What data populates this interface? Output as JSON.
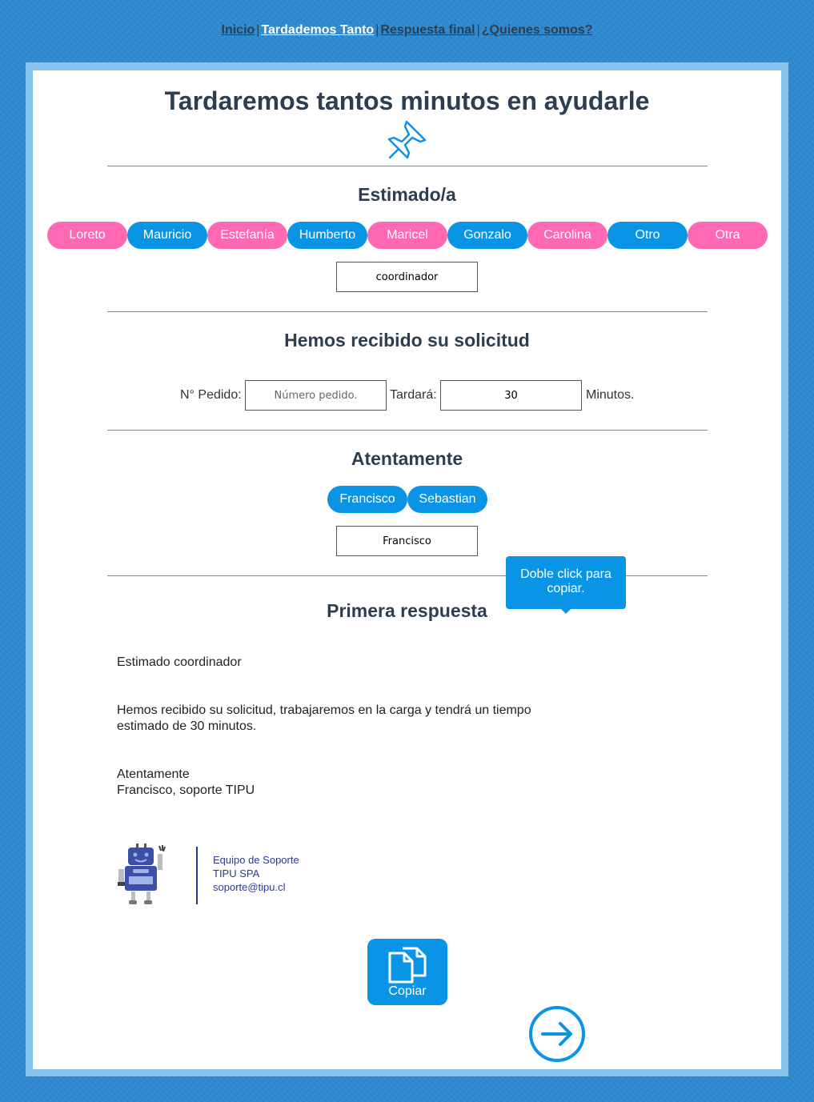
{
  "nav": {
    "items": [
      {
        "label": "Inicio",
        "active": false
      },
      {
        "label": "Tardademos Tanto",
        "active": true
      },
      {
        "label": "Respuesta final",
        "active": false
      },
      {
        "label": "¿Quienes somos?",
        "active": false
      }
    ],
    "separator": "|"
  },
  "page_title": "Tardaremos tantos minutos en ayudarle",
  "estimado": {
    "heading": "Estimado/a",
    "names": [
      {
        "label": "Loreto",
        "color": "pink"
      },
      {
        "label": "Mauricio",
        "color": "blue"
      },
      {
        "label": "Estefanía",
        "color": "pink"
      },
      {
        "label": "Humberto",
        "color": "blue"
      },
      {
        "label": "Maricel",
        "color": "pink"
      },
      {
        "label": "Gonzalo",
        "color": "blue"
      },
      {
        "label": "Carolina",
        "color": "pink"
      },
      {
        "label": "Otro",
        "color": "blue"
      },
      {
        "label": "Otra",
        "color": "pink"
      }
    ],
    "input_value": "coordinador"
  },
  "solicitud": {
    "heading": "Hemos recibido su solicitud",
    "pedido_label": "N° Pedido:",
    "pedido_placeholder": "Número pedido.",
    "tardara_label": "Tardará:",
    "minutes_value": "30",
    "minutes_label": "Minutos."
  },
  "atentamente": {
    "heading": "Atentamente",
    "names": [
      {
        "label": "Francisco",
        "color": "blue"
      },
      {
        "label": "Sebastian",
        "color": "blue"
      }
    ],
    "input_value": "Francisco"
  },
  "respuesta": {
    "heading": "Primera respuesta",
    "tooltip": "Doble click para copiar.",
    "greeting": "Estimado coordinador",
    "body": "Hemos recibido su solicitud, trabajaremos en la carga y tendrá un tiempo estimado de 30 minutos.",
    "closing": "Atentamente",
    "signer": "Francisco, soporte TIPU"
  },
  "signature": {
    "team": "Equipo de Soporte",
    "company": "TIPU SPA",
    "email": "soporte@tipu.cl"
  },
  "copy_button": {
    "label": "Copiar",
    "icon": "copy-icon"
  },
  "next_button": {
    "icon": "arrow-right-circle-icon"
  },
  "colors": {
    "pink": "#ff69b4",
    "blue": "#0a94e6",
    "background": "#2e89d0",
    "frame": "#86c4f0"
  }
}
